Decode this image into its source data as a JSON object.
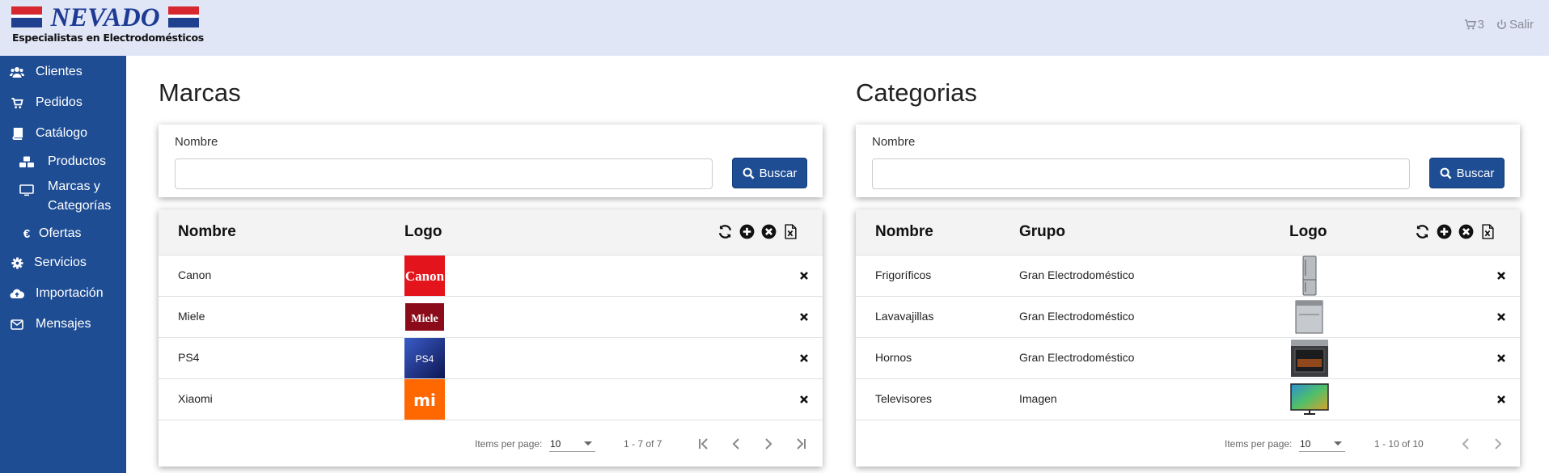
{
  "header": {
    "logo_text": "NEVADO",
    "logo_subtitle": "Especialistas en Electrodomésticos",
    "cart_count": "3",
    "logout_label": "Salir"
  },
  "sidebar": {
    "items": [
      {
        "label": "Clientes",
        "icon": "users-icon"
      },
      {
        "label": "Pedidos",
        "icon": "cart-icon"
      },
      {
        "label": "Catálogo",
        "icon": "book-icon"
      },
      {
        "label": "Productos",
        "icon": "cubes-icon"
      },
      {
        "label_line1": "Marcas y",
        "label_line2": "Categorías",
        "icon": "desktop-icon"
      },
      {
        "label": "Ofertas",
        "icon": "euro-icon"
      },
      {
        "label": "Servicios",
        "icon": "cog-icon"
      },
      {
        "label": "Importación",
        "icon": "cloud-upload-icon"
      },
      {
        "label": "Mensajes",
        "icon": "envelope-icon"
      }
    ]
  },
  "marcas": {
    "title": "Marcas",
    "filter_label": "Nombre",
    "filter_value": "",
    "search_button": "Buscar",
    "columns": [
      "Nombre",
      "Logo"
    ],
    "rows": [
      {
        "nombre": "Canon",
        "logo": "Canon",
        "logo_color": "#e3141b"
      },
      {
        "nombre": "Miele",
        "logo": "Miele",
        "logo_color": "#8c0b1a"
      },
      {
        "nombre": "PS4",
        "logo": "PS4",
        "logo_color": "#1b2a78"
      },
      {
        "nombre": "Xiaomi",
        "logo": "mi",
        "logo_color": "#ff6700"
      }
    ],
    "items_per_page_label": "Items per page:",
    "items_per_page": "10",
    "range": "1 - 7 of 7"
  },
  "categorias": {
    "title": "Categorias",
    "filter_label": "Nombre",
    "filter_value": "",
    "search_button": "Buscar",
    "columns": [
      "Nombre",
      "Grupo",
      "Logo"
    ],
    "rows": [
      {
        "nombre": "Frigoríficos",
        "grupo": "Gran Electrodoméstico",
        "logo": "fridge"
      },
      {
        "nombre": "Lavavajillas",
        "grupo": "Gran Electrodoméstico",
        "logo": "dishwasher"
      },
      {
        "nombre": "Hornos",
        "grupo": "Gran Electrodoméstico",
        "logo": "oven"
      },
      {
        "nombre": "Televisores",
        "grupo": "Imagen",
        "logo": "tv"
      }
    ],
    "items_per_page_label": "Items per page:",
    "items_per_page": "10",
    "range": "1 - 10 of 10"
  },
  "colors": {
    "sidebar": "#1e4d94",
    "header": "#e0e6f6",
    "button": "#1e4d94"
  }
}
